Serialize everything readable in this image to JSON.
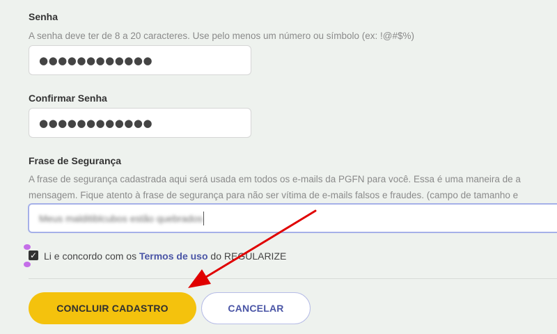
{
  "password": {
    "label": "Senha",
    "help": "A senha deve ter de 8 a 20 caracteres. Use pelo menos um número ou símbolo (ex: !@#$%)",
    "value": "●●●●●●●●●●●●"
  },
  "confirm_password": {
    "label": "Confirmar Senha",
    "value": "●●●●●●●●●●●●"
  },
  "security_phrase": {
    "label": "Frase de Segurança",
    "help_line1": "A frase de segurança cadastrada aqui será usada em todos os e-mails da PGFN para você. Essa é uma maneira de a",
    "help_line2": "mensagem. Fique atento à frase de segurança para não ser vítima de e-mails falsos e fraudes. (campo de tamanho e",
    "value": "Meus malditiblcubos estão quebrados"
  },
  "terms": {
    "prefix": "Li e concordo com os ",
    "link": "Termos de uso",
    "suffix": " do REGULARIZE",
    "checked": true
  },
  "buttons": {
    "submit": "CONCLUIR CADASTRO",
    "cancel": "CANCELAR"
  },
  "colors": {
    "background": "#eef2ee",
    "primary": "#f4c20d",
    "link": "#4a55a6",
    "annotation": "#e00000"
  }
}
